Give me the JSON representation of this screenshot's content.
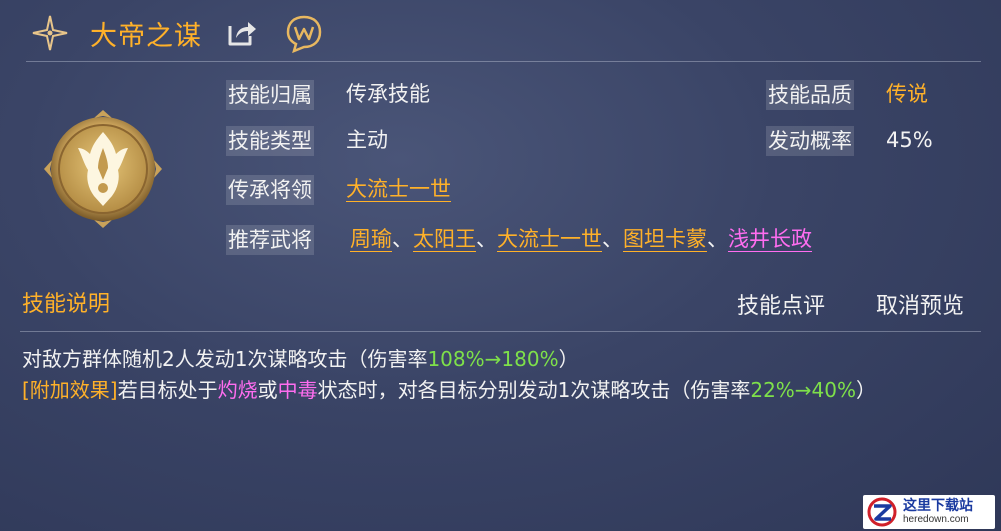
{
  "header": {
    "title": "大帝之谋"
  },
  "info": {
    "belong_label": "技能归属",
    "belong_value": "传承技能",
    "type_label": "技能类型",
    "type_value": "主动",
    "general_label": "传承将领",
    "general_value": "大流士一世",
    "recommend_label": "推荐武将",
    "recommended": [
      {
        "name": "周瑜",
        "color": "gold"
      },
      {
        "name": "太阳王",
        "color": "gold"
      },
      {
        "name": "大流士一世",
        "color": "gold"
      },
      {
        "name": "图坦卡蒙",
        "color": "gold"
      },
      {
        "name": "浅井长政",
        "color": "pink"
      }
    ],
    "separator": "、",
    "quality_label": "技能品质",
    "quality_value": "传说",
    "chance_label": "发动概率",
    "chance_value": "45%"
  },
  "section": {
    "title": "技能说明",
    "review_label": "技能点评",
    "cancel_label": "取消预览"
  },
  "description": {
    "line1_text": "对敌方群体随机2人发动1次谋略攻击（伤害率",
    "line1_rate": "108%→180%",
    "line1_end": "）",
    "line2_tag": "[附加效果]",
    "line2_a": "若目标处于",
    "line2_burn": "灼烧",
    "line2_b": "或",
    "line2_poison": "中毒",
    "line2_c": "状态时，对各目标分别发动1次谋略攻击（伤害率",
    "line2_rate": "22%→40%",
    "line2_end": "）"
  },
  "watermark": {
    "cn": "这里下载站",
    "en": "heredown.com"
  },
  "colors": {
    "gold": "#ffb129",
    "pink": "#ff6df0",
    "green": "#7ee04a",
    "background": "#3a4466"
  }
}
